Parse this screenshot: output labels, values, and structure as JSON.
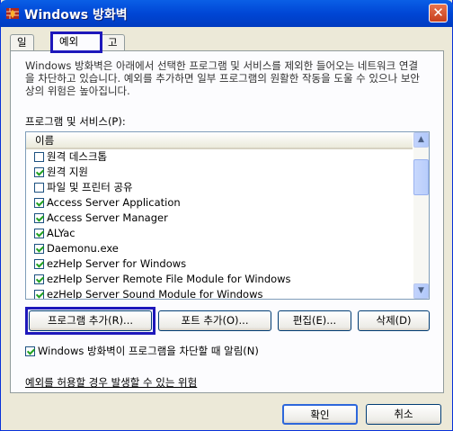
{
  "window": {
    "title": "Windows 방화벽",
    "close_glyph": "✕"
  },
  "tabs": [
    {
      "label": "일반"
    },
    {
      "label": "예외"
    },
    {
      "label": "고급"
    }
  ],
  "exceptions": {
    "description": "Windows 방화벽은 아래에서 선택한 프로그램 및 서비스를 제외한 들어오는 네트워크 연결을 차단하고 있습니다. 예외를 추가하면 일부 프로그램의 원활한 작동을 도울 수 있으나 보안상의 위험은 높아집니다.",
    "list_label": "프로그램 및 서비스(P):",
    "column_header": "이름",
    "items": [
      {
        "label": "원격 데스크톱",
        "checked": false
      },
      {
        "label": "원격 지원",
        "checked": true
      },
      {
        "label": "파일 및 프린터 공유",
        "checked": false
      },
      {
        "label": "Access Server Application",
        "checked": true
      },
      {
        "label": "Access Server Manager",
        "checked": true
      },
      {
        "label": "ALYac",
        "checked": true
      },
      {
        "label": "Daemonu.exe",
        "checked": true
      },
      {
        "label": "ezHelp Server for Windows",
        "checked": true
      },
      {
        "label": "ezHelp Server Remote File Module for Windows",
        "checked": true
      },
      {
        "label": "ezHelp Server Sound Module for Windows",
        "checked": true
      }
    ],
    "buttons": {
      "add_program": "프로그램 추가(R)...",
      "add_port": "포트 추가(O)...",
      "edit": "편집(E)...",
      "delete": "삭제(D)"
    },
    "notify_label": "Windows 방화벽이 프로그램을 차단할 때 알림(N)",
    "notify_checked": true,
    "risk_link": "예외를 허용할 경우 발생할 수 있는 위험"
  },
  "footer": {
    "ok": "확인",
    "cancel": "취소"
  },
  "colors": {
    "titlebar": "#0046d5",
    "dialog_bg": "#ece9d8",
    "highlight_box": "#1e18bb"
  }
}
